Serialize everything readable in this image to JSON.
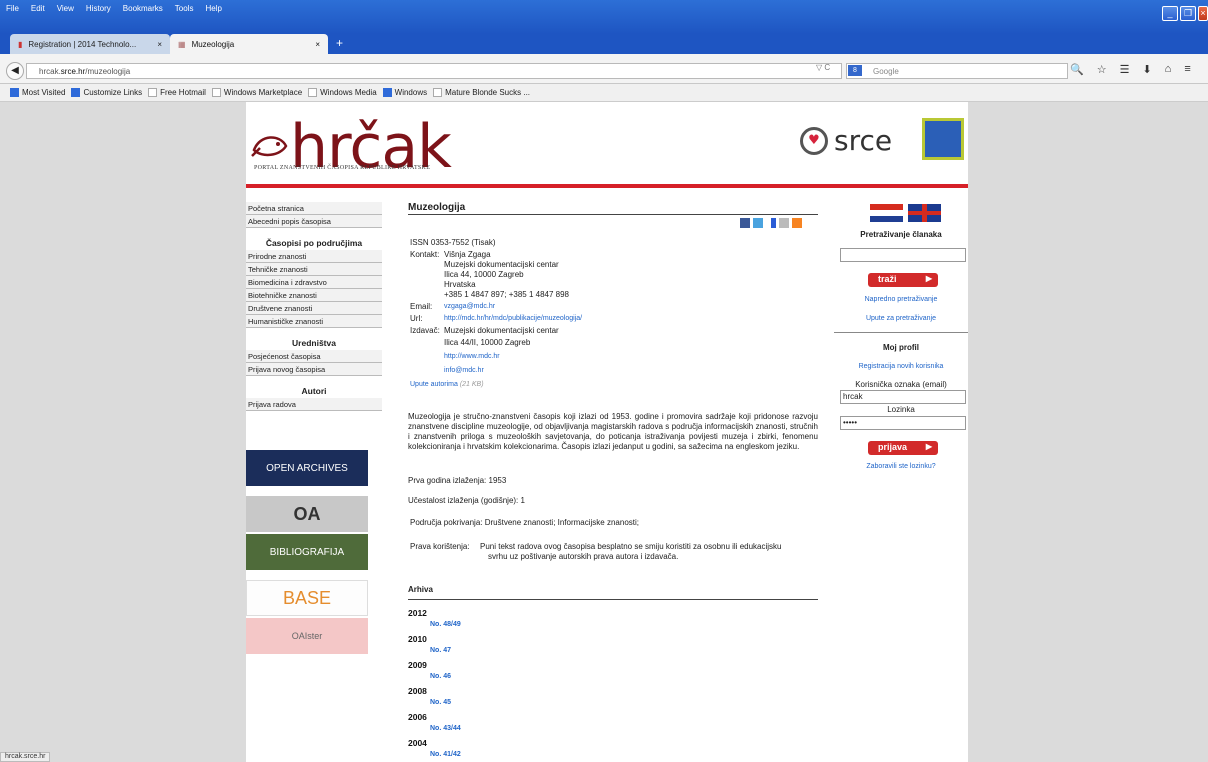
{
  "browser": {
    "menu": [
      "File",
      "Edit",
      "View",
      "History",
      "Bookmarks",
      "Tools",
      "Help"
    ],
    "tabs": [
      {
        "label": "Registration | 2014 Technolo...",
        "close": "×"
      },
      {
        "label": "Muzeologija",
        "close": "×"
      }
    ],
    "new_tab": "+",
    "url_prefix": "hrcak.",
    "url_domain": "srce.hr",
    "url_path": "/muzeologija",
    "url_controls": "▽ C",
    "search_placeholder": "Google",
    "search_engine_label": "8",
    "nav_icons": [
      "🔍",
      "☆",
      "☰",
      "⬇",
      "⌂",
      "≡"
    ]
  },
  "bookmarks": [
    {
      "label": "Most Visited",
      "icon": "blue"
    },
    {
      "label": "Customize Links",
      "icon": "blue"
    },
    {
      "label": "Free Hotmail",
      "icon": "plain"
    },
    {
      "label": "Windows Marketplace",
      "icon": "plain"
    },
    {
      "label": "Windows Media",
      "icon": "plain"
    },
    {
      "label": "Windows",
      "icon": "blue"
    },
    {
      "label": "Mature Blonde Sucks ...",
      "icon": "plain"
    }
  ],
  "header": {
    "logo_word": "hrčak",
    "tagline": "PORTAL ZNANSTVENIH ČASOPISA REPUBLIKE HRVATSKE",
    "partner": "srce"
  },
  "leftnav": {
    "items_top": [
      "Početna stranica",
      "Abecedni popis časopisa"
    ],
    "section1": "Časopisi po područjima",
    "areas": [
      "Prirodne znanosti",
      "Tehničke znanosti",
      "Biomedicina i zdravstvo",
      "Biotehničke znanosti",
      "Društvene znanosti",
      "Humanističke znanosti"
    ],
    "section2": "Uredništva",
    "editorial": [
      "Posjećenost časopisa",
      "Prijava novog časopisa"
    ],
    "section3": "Autori",
    "authors": [
      "Prijava radova"
    ],
    "badges": [
      "OPEN ARCHIVES",
      "OA",
      "BIBLIOGRAFIJA",
      "BASE",
      "OAIster"
    ]
  },
  "journal": {
    "title": "Muzeologija",
    "issn": "ISSN 0353-7552 (Tisak)",
    "contact_label": "Kontakt:",
    "contact_lines": [
      "Višnja Zgaga",
      "Muzejski dokumentacijski centar",
      "Ilica 44, 10000 Zagreb",
      "Hrvatska",
      "+385 1 4847 897; +385 1 4847 898"
    ],
    "email_label": "Email:",
    "email": "vzgaga@mdc.hr",
    "url_label": "Url:",
    "url": "http://mdc.hr/hr/mdc/publikacije/muzeologija/",
    "publisher_label": "Izdavač:",
    "publisher_lines": [
      "Muzejski dokumentacijski centar",
      "Ilica 44/II, 10000 Zagreb"
    ],
    "publisher_web": "http://www.mdc.hr",
    "publisher_email": "info@mdc.hr",
    "guide_link": "Upute autorima",
    "guide_size": "(21 KB)",
    "description": "Muzeologija je stručno-znanstveni časopis koji izlazi od 1953. godine i promovira sadržaje koji pridonose razvoju znanstvene discipline muzeologije, od objavljivanja magistarskih radova s područja informacijskih znanosti, stručnih i znanstvenih priloga s muzeoloških savjetovanja, do poticanja istraživanja povijesti muzeja i zbirki, fenomenu kolekcioniranja i hrvatskim kolekcionarima. Časopis izlazi jedanput u godini, sa sažecima na engleskom jeziku.",
    "first_year": "Prva godina izlaženja: 1953",
    "frequency": "Učestalost izlaženja (godišnje): 1",
    "fields": "Područja pokrivanja: Društvene znanosti; Informacijske znanosti;",
    "rights_label": "Prava korištenja:",
    "rights_line1": "Puni tekst radova ovog časopisa besplatno se smiju koristiti za osobnu ili edukacijsku",
    "rights_line2": "svrhu uz poštivanje autorskih prava autora i izdavača.",
    "archive_heading": "Arhiva",
    "archive": [
      {
        "year": "2012",
        "issue": "No. 48/49"
      },
      {
        "year": "2010",
        "issue": "No. 47"
      },
      {
        "year": "2009",
        "issue": "No. 46"
      },
      {
        "year": "2008",
        "issue": "No. 45"
      },
      {
        "year": "2006",
        "issue": "No. 43/44"
      },
      {
        "year": "2004",
        "issue": "No. 41/42"
      }
    ]
  },
  "sidebar": {
    "search_heading": "Pretraživanje članaka",
    "search_button": "traži",
    "advanced_link": "Napredno pretraživanje",
    "help_link": "Upute za pretraživanje",
    "profile_heading": "Moj profil",
    "register_link": "Registracija novih korisnika",
    "user_label": "Korisnička oznaka (email)",
    "user_value": "hrcak",
    "password_label": "Lozinka",
    "password_value": "•••••",
    "login_button": "prijava",
    "forgot_link": "Zaboravili ste lozinku?"
  },
  "status": "hrcak.srce.hr"
}
